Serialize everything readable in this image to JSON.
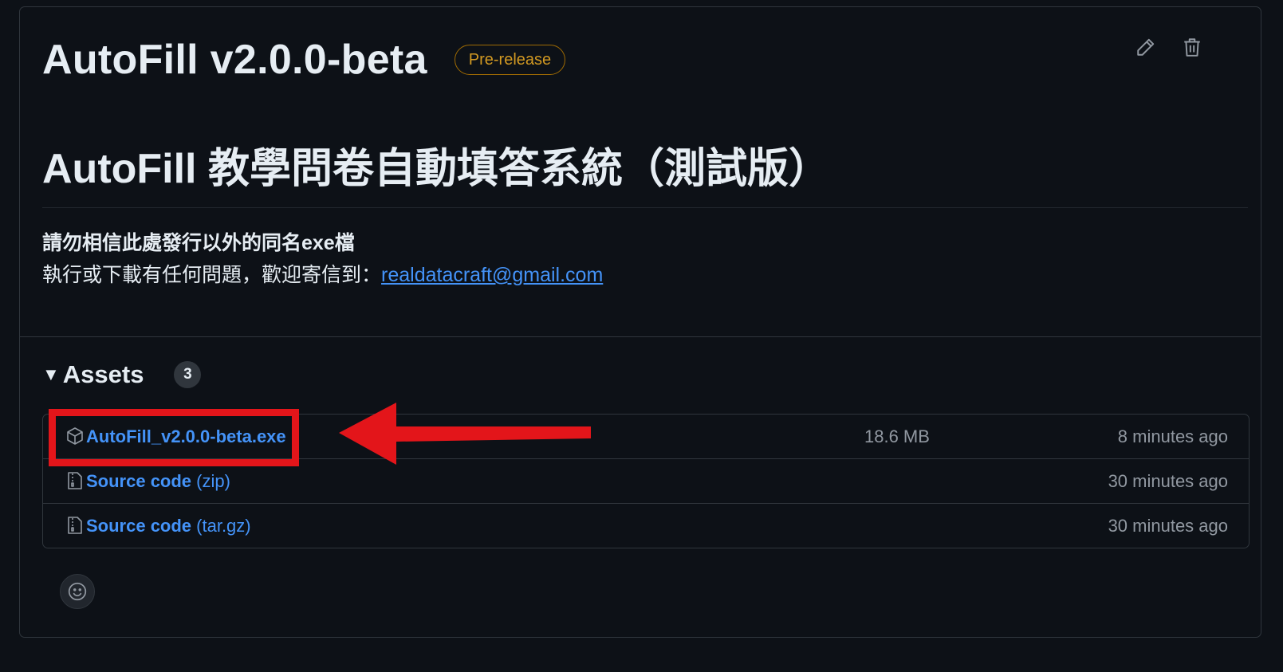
{
  "release": {
    "title": "AutoFill v2.0.0-beta",
    "badge": "Pre-release",
    "body_title": "AutoFill 教學問卷自動填答系統（測試版）",
    "notice": "請勿相信此處發行以外的同名exe檔",
    "contact_text": "執行或下載有任何問題，歡迎寄信到：",
    "contact_email": "realdatacraft@gmail.com"
  },
  "toolbar": {
    "edit_icon": "pencil-icon",
    "delete_icon": "trash-icon"
  },
  "assets": {
    "label": "Assets",
    "count": "3",
    "items": [
      {
        "icon": "package-icon",
        "name": "AutoFill_v2.0.0-beta.exe",
        "suffix": "",
        "size": "18.6 MB",
        "time": "8 minutes ago"
      },
      {
        "icon": "file-zip-icon",
        "name": "Source code",
        "suffix": " (zip)",
        "size": "",
        "time": "30 minutes ago"
      },
      {
        "icon": "file-zip-icon",
        "name": "Source code",
        "suffix": " (tar.gz)",
        "size": "",
        "time": "30 minutes ago"
      }
    ]
  },
  "annotation": {
    "box_color": "#e3151a",
    "arrow_color": "#e3151a"
  },
  "reaction": {
    "icon": "smiley-icon"
  },
  "colors": {
    "background": "#0d1117",
    "link": "#4493f8",
    "badge": "#d29922",
    "muted": "#9198a1"
  }
}
